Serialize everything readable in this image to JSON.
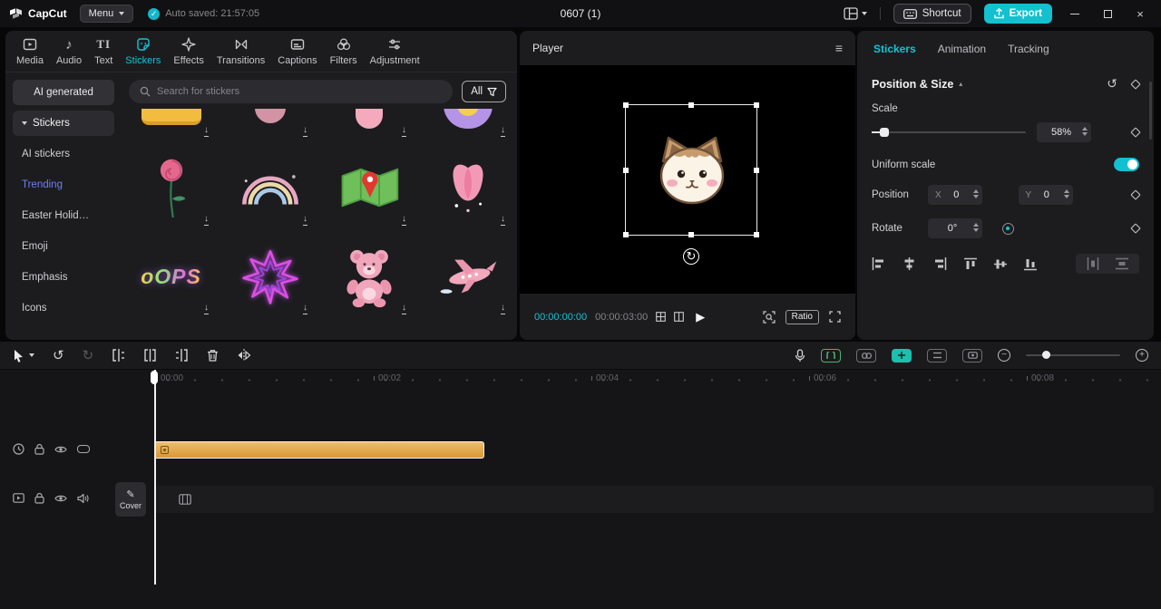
{
  "colors": {
    "accent": "#16c2d2",
    "export_button": "#13c0d0",
    "clip": "#e0a64e",
    "trending_link": "#6f7df4"
  },
  "icons": {
    "check": "✓",
    "close": "×",
    "hamburger": "≡",
    "play": "▶",
    "undo": "↺",
    "redo": "↻",
    "arrow_down": "↓",
    "pencil": "✎",
    "rotate": "↻",
    "note": "♪",
    "caret_up": "▴",
    "minus": "−",
    "plus": "+",
    "text_tool": "TI"
  },
  "titlebar": {
    "app_name": "CapCut",
    "menu_label": "Menu",
    "autosave_text": "Auto saved: 21:57:05",
    "doc_title": "0607 (1)",
    "shortcut_label": "Shortcut",
    "export_label": "Export"
  },
  "media_panel": {
    "active_tab": "Stickers",
    "tabs": [
      {
        "label": "Media"
      },
      {
        "label": "Audio"
      },
      {
        "label": "Text"
      },
      {
        "label": "Stickers"
      },
      {
        "label": "Effects"
      },
      {
        "label": "Transitions"
      },
      {
        "label": "Captions"
      },
      {
        "label": "Filters"
      },
      {
        "label": "Adjustment"
      }
    ],
    "sidebar": {
      "items": [
        {
          "label": "AI generated"
        },
        {
          "label": "Stickers"
        },
        {
          "label": "AI stickers"
        },
        {
          "label": "Trending"
        },
        {
          "label": "Easter Holid…"
        },
        {
          "label": "Emoji"
        },
        {
          "label": "Emphasis"
        },
        {
          "label": "Icons"
        }
      ],
      "selected": "Stickers"
    },
    "search": {
      "placeholder": "Search for stickers",
      "filter_label": "All"
    },
    "stickers": {
      "oops_text": "oOPS",
      "items_row_partial": [
        "yellow-banner",
        "pink-petals",
        "pink-flower",
        "purple-shell"
      ],
      "items_row_2": [
        "rose",
        "rainbow",
        "map-location",
        "tulip"
      ],
      "items_row_3": [
        "oops-neon-text",
        "neon-starburst",
        "teddy-bear",
        "airplane"
      ]
    }
  },
  "player": {
    "title": "Player",
    "current_time": "00:00:00:00",
    "total_time": "00:00:03:00",
    "ratio_label": "Ratio"
  },
  "inspector": {
    "active_tab": "Stickers",
    "tabs": [
      {
        "label": "Stickers"
      },
      {
        "label": "Animation"
      },
      {
        "label": "Tracking"
      }
    ],
    "section_title": "Position & Size",
    "scale": {
      "label": "Scale",
      "value": "58%"
    },
    "uniform_scale": {
      "label": "Uniform scale",
      "enabled": true
    },
    "position": {
      "label": "Position",
      "x_label": "X",
      "x_value": "0",
      "y_label": "Y",
      "y_value": "0"
    },
    "rotate": {
      "label": "Rotate",
      "value": "0°"
    }
  },
  "timeline": {
    "ruler_labels": [
      "00:00",
      "00:02",
      "00:04",
      "00:06",
      "00:08"
    ],
    "cover_label": "Cover"
  }
}
